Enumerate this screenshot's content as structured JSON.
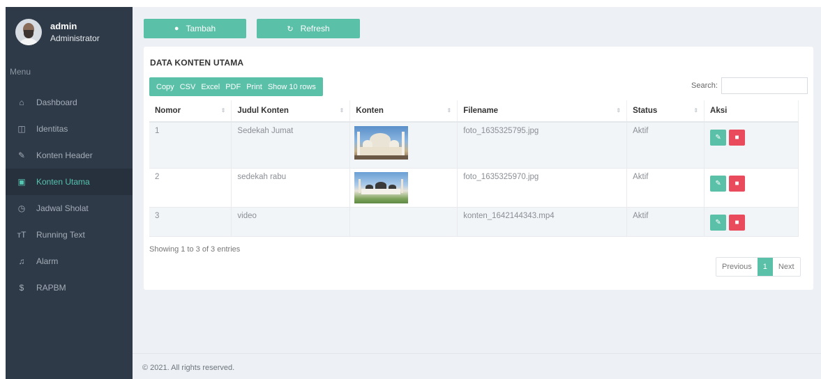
{
  "user": {
    "name": "admin",
    "role": "Administrator"
  },
  "sidebar": {
    "menu_title": "Menu",
    "items": [
      {
        "label": "Dashboard",
        "icon": "home-icon",
        "glyph": "⌂",
        "active": false
      },
      {
        "label": "Identitas",
        "icon": "columns-icon",
        "glyph": "◫",
        "active": false
      },
      {
        "label": "Konten Header",
        "icon": "pencil-icon",
        "glyph": "✎",
        "active": false
      },
      {
        "label": "Konten Utama",
        "icon": "image-icon",
        "glyph": "▣",
        "active": true
      },
      {
        "label": "Jadwal Sholat",
        "icon": "clock-icon",
        "glyph": "◷",
        "active": false
      },
      {
        "label": "Running Text",
        "icon": "text-height-icon",
        "glyph": "ᴛT",
        "active": false
      },
      {
        "label": "Alarm",
        "icon": "bell-icon",
        "glyph": "♫",
        "active": false
      },
      {
        "label": "RAPBM",
        "icon": "dollar-icon",
        "glyph": "$",
        "active": false
      }
    ]
  },
  "toolbar": {
    "add_label": "Tambah",
    "refresh_label": "Refresh"
  },
  "card": {
    "title": "DATA KONTEN UTAMA",
    "export_buttons": [
      "Copy",
      "CSV",
      "Excel",
      "PDF",
      "Print",
      "Show 10 rows"
    ],
    "search_label": "Search:",
    "search_value": ""
  },
  "table": {
    "columns": [
      "Nomor",
      "Judul Konten",
      "Konten",
      "Filename",
      "Status",
      "Aksi"
    ],
    "rows": [
      {
        "nomor": "1",
        "judul": "Sedekah Jumat",
        "konten": "image-mosque-1",
        "filename": "foto_1635325795.jpg",
        "status": "Aktif"
      },
      {
        "nomor": "2",
        "judul": "sedekah rabu",
        "konten": "image-mosque-2",
        "filename": "foto_1635325970.jpg",
        "status": "Aktif"
      },
      {
        "nomor": "3",
        "judul": "video",
        "konten": "",
        "filename": "konten_1642144343.mp4",
        "status": "Aktif"
      }
    ]
  },
  "info": "Showing 1 to 3 of 3 entries",
  "pagination": {
    "previous": "Previous",
    "current": "1",
    "next": "Next"
  },
  "footer": "© 2021. All rights reserved.",
  "colors": {
    "sidebar_bg": "#2e3a48",
    "accent": "#5bc0a8",
    "danger": "#e94b5c",
    "main_bg": "#edf0f4"
  }
}
